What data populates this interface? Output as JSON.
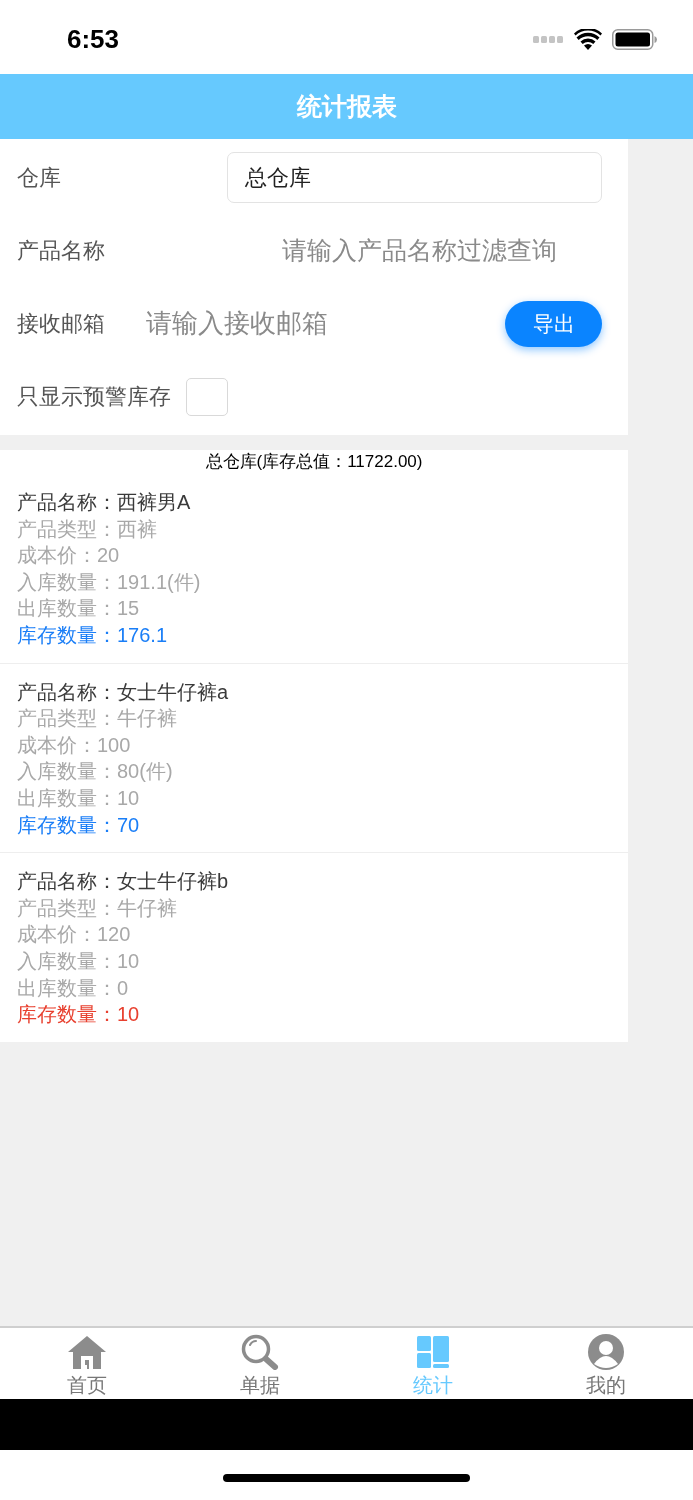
{
  "status_bar": {
    "time": "6:53"
  },
  "header": {
    "title": "统计报表"
  },
  "filters": {
    "warehouse": {
      "label": "仓库",
      "value": "总仓库"
    },
    "product_name": {
      "label": "产品名称",
      "placeholder": "请输入产品名称过滤查询"
    },
    "email": {
      "label": "接收邮箱",
      "placeholder": "请输入接收邮箱"
    },
    "export_button": "导出",
    "warning_only": {
      "label": "只显示预警库存",
      "checked": false
    }
  },
  "report": {
    "title": "总仓库(库存总值：11722.00)",
    "products": [
      {
        "name": "产品名称：西裤男A",
        "type": "产品类型：西裤",
        "cost": "成本价：20",
        "inbound": "入库数量：191.1(件)",
        "outbound": "出库数量：15",
        "stock": "库存数量：176.1",
        "alert": false
      },
      {
        "name": "产品名称：女士牛仔裤a",
        "type": "产品类型：牛仔裤",
        "cost": "成本价：100",
        "inbound": "入库数量：80(件)",
        "outbound": "出库数量：10",
        "stock": "库存数量：70",
        "alert": false
      },
      {
        "name": "产品名称：女士牛仔裤b",
        "type": "产品类型：牛仔裤",
        "cost": "成本价：120",
        "inbound": "入库数量：10",
        "outbound": "出库数量：0",
        "stock": "库存数量：10",
        "alert": true
      }
    ]
  },
  "tab_bar": {
    "tabs": [
      {
        "label": "首页",
        "selected": false
      },
      {
        "label": "单据",
        "selected": false
      },
      {
        "label": "统计",
        "selected": true
      },
      {
        "label": "我的",
        "selected": false
      }
    ]
  }
}
